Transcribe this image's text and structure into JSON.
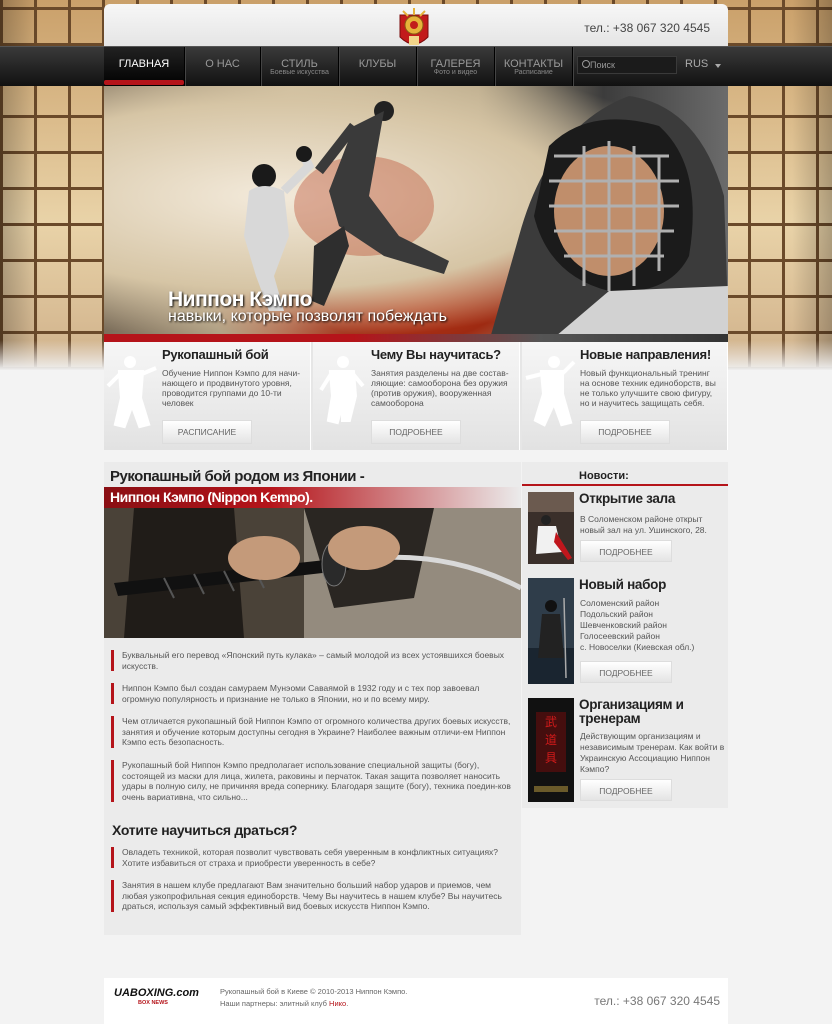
{
  "header": {
    "phone": "тел.: +38 067 320 4545"
  },
  "nav": {
    "items": [
      {
        "label": "ГЛАВНАЯ",
        "sub": ""
      },
      {
        "label": "О НАС",
        "sub": ""
      },
      {
        "label": "СТИЛЬ",
        "sub": "Боевые искусства"
      },
      {
        "label": "КЛУБЫ",
        "sub": ""
      },
      {
        "label": "ГАЛЕРЕЯ",
        "sub": "Фото и видео"
      },
      {
        "label": "КОНТАКТЫ",
        "sub": "Расписание"
      }
    ],
    "search_placeholder": "Поиск",
    "lang": "RUS"
  },
  "hero": {
    "title": "Ниппон Кэмпо",
    "subtitle": "навыки, которые позволят побеждать"
  },
  "features": [
    {
      "title": "Рукопашный бой",
      "text": "Обучение Ниппон Кэмпо для начи-нающего и продвинутого уровня, проводится группами до 10-ти человек",
      "button": "РАСПИСАНИЕ"
    },
    {
      "title": "Чему Вы научитась?",
      "text": "Занятия разделены на две состав-ляющие: самооборона без оружия (против оружия), вооруженная самооборона",
      "button": "ПОДРОБНЕЕ"
    },
    {
      "title": "Новые направления!",
      "text": "Новый функциональный тренинг на основе техник единоборств, вы не только улучшите свою фигуру, но и научитесь защищать себя.",
      "button": "ПОДРОБНЕЕ"
    }
  ],
  "article": {
    "heading": "Рукопашный бой родом из Японии -",
    "band": "Ниппон Кэмпо (Nippon Kempo).",
    "paragraphs": [
      "Буквальный его перевод «Японский путь кулака» – самый молодой из всех устоявшихся боевых искусств.",
      "Ниппон Кэмпо был создан самураем Мунэоми Саваямой в 1932 году и с тех пор завоевал огромную популярность и признание не только в Японии, но и по всему миру.",
      "Чем отличается рукопашный бой Ниппон Кэмпо от огромного количества других боевых искусств, занятия и обучение которым доступны сегодня в Украине? Наиболее важным отличи-ем Ниппон Кэмпо есть безопасность.",
      "Рукопашный бой Ниппон Кэмпо предполагает использование специальной защиты (богу), состоящей из маски для лица, жилета, раковины и перчаток. Такая защита позволяет наносить удары в полную силу, не причиняя вреда сопернику. Благодаря защите (богу), техника поедин-ков очень вариативна, что сильно..."
    ],
    "heading2": "Хотите научиться драться?",
    "paragraphs2": [
      "Овладеть техникой, которая позволит чувствовать себя уверенным в конфликтных ситуациях? Хотите избавиться от страха и приобрести уверенность в себе?",
      "Занятия в нашем клубе предлагают Вам значительно больший набор ударов и приемов, чем любая узкопрофильная секция единоборств. Чему Вы научитесь в нашем клубе? Вы научитесь драться, используя самый эффективный вид боевых искусств Ниппон Кэмпо."
    ]
  },
  "news": {
    "heading": "Новости:",
    "items": [
      {
        "title": "Открытие зала",
        "text": "В Соломенском районе открыт новый зал на ул. Ушинского, 28.",
        "button": "ПОДРОБНЕЕ"
      },
      {
        "title": "Новый набор",
        "text": "Соломенский район\nПодольский район\nШевченковский район\nГолосеевский район\nс. Новоселки (Киевская обл.)",
        "button": "ПОДРОБНЕЕ"
      },
      {
        "title": "Организациям и тренерам",
        "text": "Действующим организациям и независимым тренерам. Как войти в Украинскую Ассоциацию Ниппон Кэмпо?",
        "button": "ПОДРОБНЕЕ"
      }
    ]
  },
  "footer": {
    "logo": "UABOXING.com",
    "logo_sub": "BOX NEWS",
    "copyright": "Рукопашный бой в Киеве © 2010-2013 Ниппон Кэмпо.",
    "partners_prefix": "Наши партнеры: элитный клуб ",
    "partner": "Нико",
    "partners_suffix": ".",
    "phone": "тел.: +38 067 320 4545"
  },
  "colors": {
    "accent": "#b5141a",
    "nav_bg": "#111111"
  }
}
